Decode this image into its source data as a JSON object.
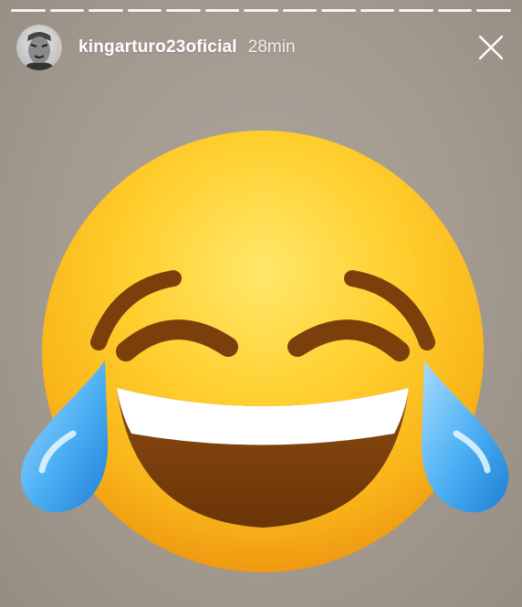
{
  "story": {
    "username": "kingarturo23oficial",
    "timestamp": "28min",
    "segment_count": 13,
    "content": {
      "type": "emoji",
      "emoji": "😂",
      "emoji_name": "face-with-tears-of-joy"
    }
  },
  "icons": {
    "close": "close-icon",
    "avatar": "avatar"
  },
  "colors": {
    "background": "#a39a90",
    "progress": "#ffffff",
    "emoji_face": "#f9b51a",
    "tears": "#3ba2f0"
  }
}
